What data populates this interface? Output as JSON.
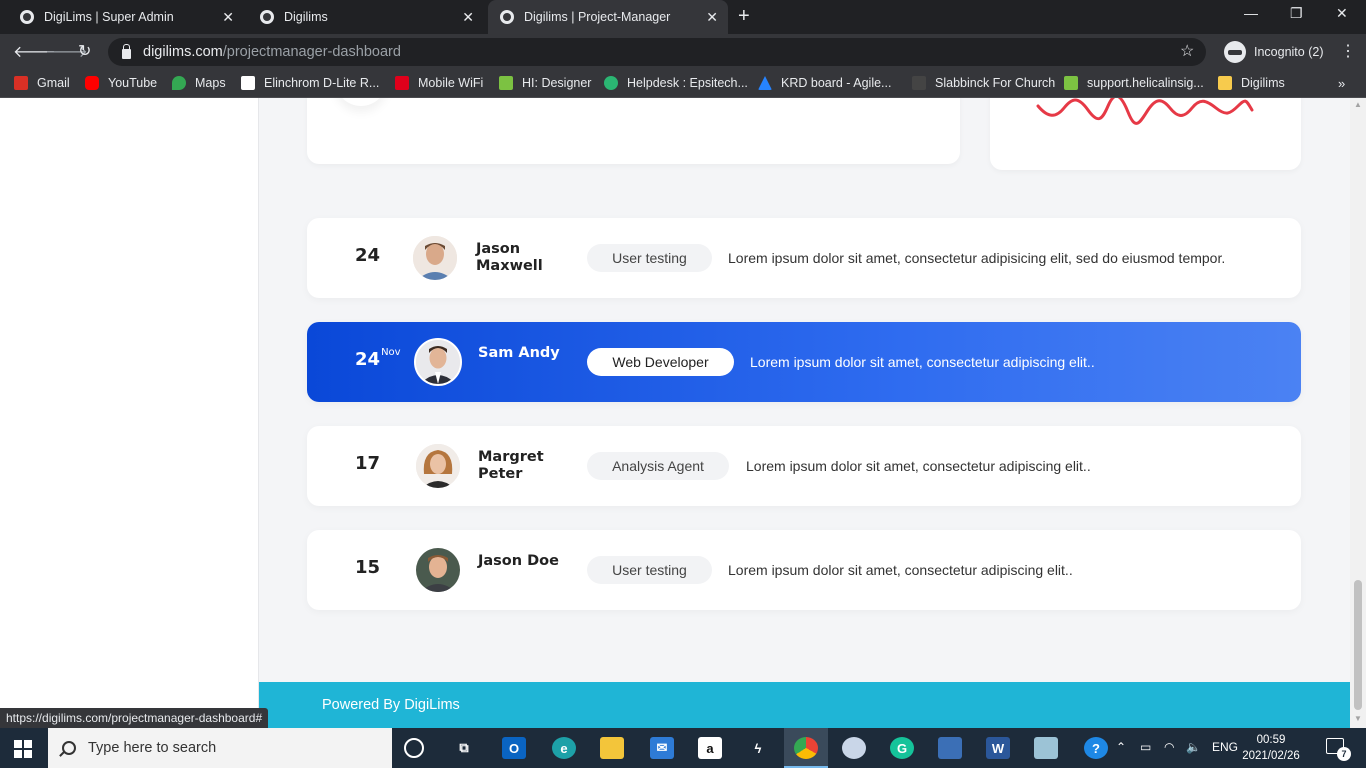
{
  "browser": {
    "tabs": [
      {
        "title": "DigiLims | Super Admin",
        "active": false
      },
      {
        "title": "Digilims",
        "active": false
      },
      {
        "title": "Digilims | Project-Manager",
        "active": true
      }
    ],
    "url_host": "digilims.com",
    "url_path": "/projectmanager-dashboard",
    "incognito_label": "Incognito (2)",
    "bookmarks": [
      {
        "label": "Gmail",
        "icon": "gmail-icon",
        "color": "#d93025"
      },
      {
        "label": "YouTube",
        "icon": "youtube-icon",
        "color": "#ff0000"
      },
      {
        "label": "Maps",
        "icon": "maps-icon",
        "color": "#34a853"
      },
      {
        "label": "Elinchrom D-Lite R...",
        "icon": "elinchrom-icon",
        "color": "#ffffff"
      },
      {
        "label": "Mobile WiFi",
        "icon": "huawei-icon",
        "color": "#e0001b"
      },
      {
        "label": "HI: Designer",
        "icon": "hi-designer-icon",
        "color": "#7cc242"
      },
      {
        "label": "Helpdesk : Epsitech...",
        "icon": "helpdesk-icon",
        "color": "#2bb673"
      },
      {
        "label": "KRD board - Agile...",
        "icon": "jira-icon",
        "color": "#2684ff"
      },
      {
        "label": "Slabbinck For Church",
        "icon": "slabbinck-icon",
        "color": "#444444"
      },
      {
        "label": "support.helicalinsig...",
        "icon": "helical-icon",
        "color": "#7cc242"
      },
      {
        "label": "Digilims",
        "icon": "folder-icon",
        "color": "#f7cb4d"
      }
    ],
    "status_url": "https://digilims.com/projectmanager-dashboard#"
  },
  "schedule": {
    "rows": [
      {
        "day": "24",
        "sup": "",
        "name": "Jason Maxwell",
        "role": "User testing",
        "desc": "Lorem ipsum dolor sit amet, consectetur adipisicing elit, sed do eiusmod tempor.",
        "active": false
      },
      {
        "day": "24",
        "sup": "Nov",
        "name": "Sam Andy",
        "role": "Web Developer",
        "desc": "Lorem ipsum dolor sit amet, consectetur adipiscing elit..",
        "active": true
      },
      {
        "day": "17",
        "sup": "",
        "name": "Margret Peter",
        "role": "Analysis Agent",
        "desc": "Lorem ipsum dolor sit amet, consectetur adipiscing elit..",
        "active": false
      },
      {
        "day": "15",
        "sup": "",
        "name": "Jason Doe",
        "role": "User testing",
        "desc": "Lorem ipsum dolor sit amet, consectetur adipiscing elit..",
        "active": false
      }
    ]
  },
  "footer": {
    "text": "Powered By DigiLims"
  },
  "taskbar": {
    "search_placeholder": "Type here to search",
    "language": "ENG",
    "time": "00:59",
    "date": "2021/02/26",
    "notification_count": "7"
  },
  "colors": {
    "accent": "#0a48d8",
    "footer": "#1fb5d6",
    "sparkline": "#e63946"
  }
}
